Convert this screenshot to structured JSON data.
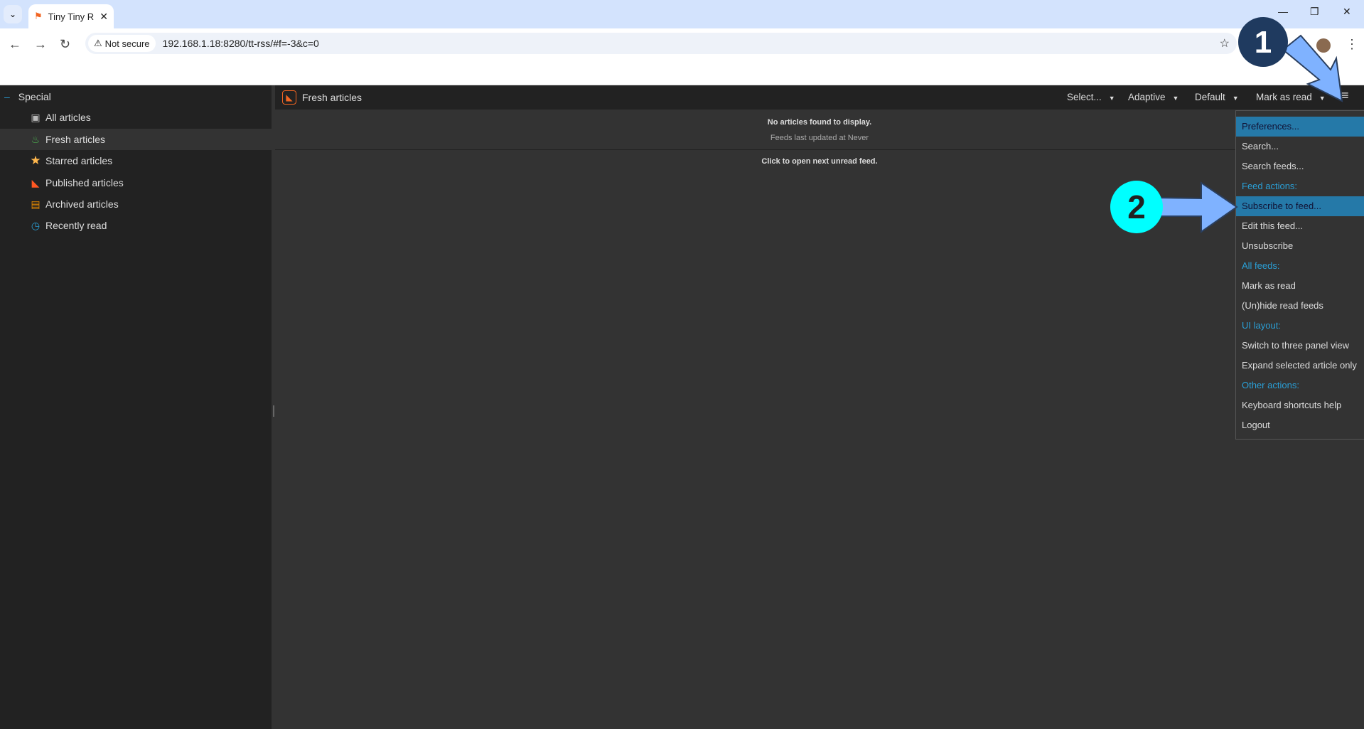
{
  "browser": {
    "tab_title": "Tiny Tiny R",
    "not_secure": "Not secure",
    "url": "192.168.1.18:8280/tt-rss/#f=-3&c=0"
  },
  "sidebar": {
    "category": "Special",
    "items": [
      {
        "label": "All articles",
        "icon": "inbox-icon",
        "color": "#bbbbbb"
      },
      {
        "label": "Fresh articles",
        "icon": "fire-icon",
        "color": "#4caf50"
      },
      {
        "label": "Starred articles",
        "icon": "star-icon",
        "color": "#ffb74d"
      },
      {
        "label": "Published articles",
        "icon": "rss-icon",
        "color": "#ff5722"
      },
      {
        "label": "Archived articles",
        "icon": "archive-icon",
        "color": "#e68a00"
      },
      {
        "label": "Recently read",
        "icon": "history-icon",
        "color": "#2a9fd6"
      }
    ]
  },
  "header": {
    "title": "Fresh articles",
    "select": "Select...",
    "adaptive": "Adaptive",
    "default": "Default",
    "mark_as_read": "Mark as read"
  },
  "content": {
    "no_articles": "No articles found to display.",
    "last_updated": "Feeds last updated at Never",
    "next_feed": "Click to open next unread feed."
  },
  "menu": {
    "items": [
      {
        "label": "Preferences...",
        "type": "item",
        "highlight": true
      },
      {
        "label": "Search...",
        "type": "item"
      },
      {
        "label": "Search feeds...",
        "type": "item"
      },
      {
        "label": "Feed actions:",
        "type": "group"
      },
      {
        "label": "Subscribe to feed...",
        "type": "item",
        "highlight": true
      },
      {
        "label": "Edit this feed...",
        "type": "item"
      },
      {
        "label": "Unsubscribe",
        "type": "item"
      },
      {
        "label": "All feeds:",
        "type": "group"
      },
      {
        "label": "Mark as read",
        "type": "item"
      },
      {
        "label": "(Un)hide read feeds",
        "type": "item"
      },
      {
        "label": "UI layout:",
        "type": "group"
      },
      {
        "label": "Switch to three panel view",
        "type": "item"
      },
      {
        "label": "Expand selected article only",
        "type": "item"
      },
      {
        "label": "Other actions:",
        "type": "group"
      },
      {
        "label": "Keyboard shortcuts help",
        "type": "item"
      },
      {
        "label": "Logout",
        "type": "item"
      }
    ]
  },
  "annotations": {
    "step1": "1",
    "step2": "2",
    "step1_color": "#1f3a5f",
    "step2_color": "#00ffff",
    "arrow_color": "#7fb2ff"
  }
}
